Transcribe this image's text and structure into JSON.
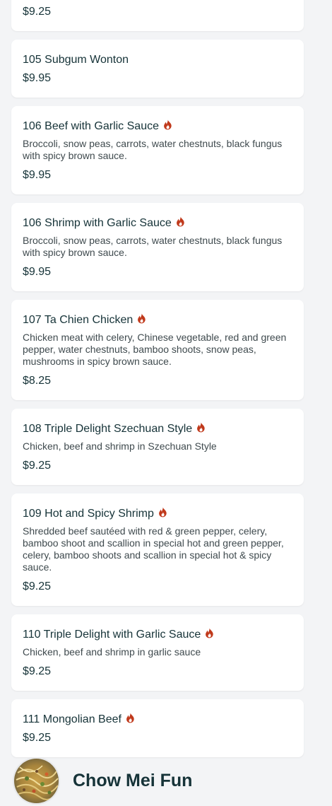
{
  "accent_color": "#c0391b",
  "items": [
    {
      "name": "",
      "spicy": false,
      "description": "",
      "price": "$9.25"
    },
    {
      "name": "105 Subgum Wonton",
      "spicy": false,
      "description": "",
      "price": "$9.95"
    },
    {
      "name": "106 Beef with Garlic Sauce",
      "spicy": true,
      "description": "Broccoli, snow peas, carrots, water chestnuts, black fungus with spicy brown sauce.",
      "price": "$9.95"
    },
    {
      "name": "106 Shrimp with Garlic Sauce",
      "spicy": true,
      "description": "Broccoli, snow peas, carrots, water chestnuts, black fungus with spicy brown sauce.",
      "price": "$9.95"
    },
    {
      "name": "107 Ta Chien Chicken",
      "spicy": true,
      "description": "Chicken meat with celery, Chinese vegetable, red and green pepper, water chestnuts, bamboo shoots, snow peas, mushrooms in spicy brown sauce.",
      "price": "$8.25"
    },
    {
      "name": "108 Triple Delight Szechuan Style",
      "spicy": true,
      "description": "Chicken, beef and shrimp in Szechuan Style",
      "price": "$9.25"
    },
    {
      "name": "109 Hot and Spicy Shrimp",
      "spicy": true,
      "description": "Shredded beef sautéed with red & green pepper, celery, bamboo shoot and scallion in special hot and green pepper, celery, bamboo shoots and scallion in special hot & spicy sauce.",
      "price": "$9.25"
    },
    {
      "name": "110 Triple Delight with Garlic Sauce",
      "spicy": true,
      "description": "Chicken, beef and shrimp in garlic sauce",
      "price": "$9.25"
    },
    {
      "name": "111 Mongolian Beef",
      "spicy": true,
      "description": "",
      "price": "$9.25"
    }
  ],
  "next_section": {
    "title": "Chow Mei Fun",
    "image": "noodle-dish-photo"
  }
}
